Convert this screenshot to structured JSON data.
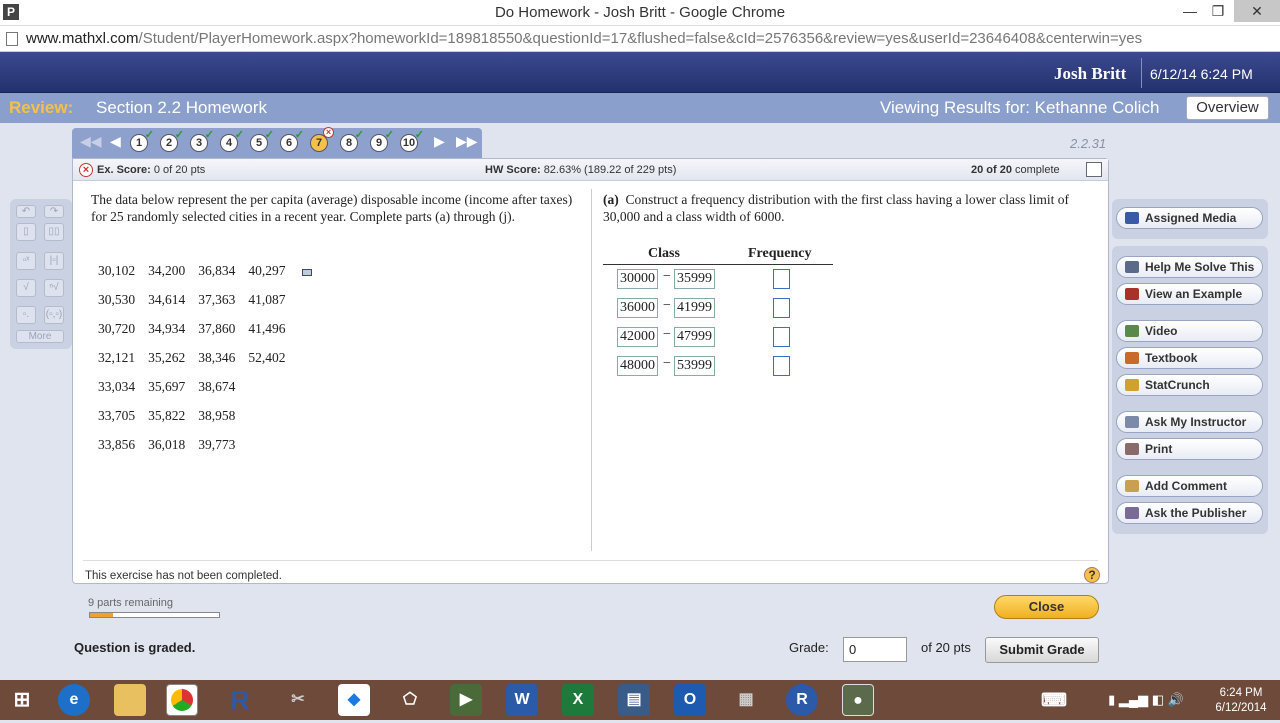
{
  "window": {
    "title": "Do Homework - Josh Britt - Google Chrome",
    "app_icon": "P"
  },
  "url": {
    "host": "www.mathxl.com",
    "path": "/Student/PlayerHomework.aspx?homeworkId=189818550&questionId=17&flushed=false&cId=2576356&review=yes&userId=23646408&centerwin=yes"
  },
  "header": {
    "user": "Josh Britt",
    "datetime": "6/12/14 6:24 PM"
  },
  "review": {
    "label": "Review:",
    "section": "Section 2.2 Homework",
    "viewing": "Viewing Results for: Kethanne Colich",
    "overview": "Overview"
  },
  "qnav": {
    "questions": [
      "1",
      "2",
      "3",
      "4",
      "5",
      "6",
      "7",
      "8",
      "9",
      "10"
    ],
    "current": "7",
    "question_id": "2.2.31"
  },
  "score": {
    "ex_label": "Ex. Score:",
    "ex_value": "0 of 20 pts",
    "hw_label": "HW Score:",
    "hw_value": "82.63% (189.22 of 229 pts)",
    "complete_count": "20 of 20",
    "complete_word": "complete"
  },
  "question": {
    "text": "The data below represent the per capita (average) disposable income (income after taxes) for 25 randomly selected cities in a recent year. Complete parts (a) through (j).",
    "data": [
      [
        "30,102",
        "34,200",
        "36,834",
        "40,297"
      ],
      [
        "30,530",
        "34,614",
        "37,363",
        "41,087"
      ],
      [
        "30,720",
        "34,934",
        "37,860",
        "41,496"
      ],
      [
        "32,121",
        "35,262",
        "38,346",
        "52,402"
      ],
      [
        "33,034",
        "35,697",
        "38,674",
        ""
      ],
      [
        "33,705",
        "35,822",
        "38,958",
        ""
      ],
      [
        "33,856",
        "36,018",
        "39,773",
        ""
      ]
    ]
  },
  "part_a": {
    "label": "(a)",
    "text": "Construct a frequency distribution with the first class having a lower class limit of 30,000 and a class width of 6000.",
    "col_class": "Class",
    "col_freq": "Frequency",
    "rows": [
      {
        "low": "30000",
        "high": "35999"
      },
      {
        "low": "36000",
        "high": "41999"
      },
      {
        "low": "42000",
        "high": "47999"
      },
      {
        "low": "48000",
        "high": "53999"
      }
    ],
    "dash": "−"
  },
  "footer": {
    "status": "This exercise has not been completed.",
    "help": "?"
  },
  "tools": {
    "more": "More"
  },
  "sidebar": {
    "assigned_media": "Assigned Media",
    "help_solve": "Help Me Solve This",
    "example": "View an Example",
    "video": "Video",
    "textbook": "Textbook",
    "statcrunch": "StatCrunch",
    "ask_instructor": "Ask My Instructor",
    "print": "Print",
    "add_comment": "Add Comment",
    "ask_publisher": "Ask the Publisher"
  },
  "bottom": {
    "parts_remaining": "9 parts remaining",
    "progress": 0.18,
    "close": "Close",
    "graded": "Question is graded.",
    "grade_label": "Grade:",
    "grade_value": "0",
    "of_pts": "of 20 pts",
    "submit": "Submit Grade"
  },
  "taskbar": {
    "time": "6:24 PM",
    "date": "6/12/2014"
  }
}
